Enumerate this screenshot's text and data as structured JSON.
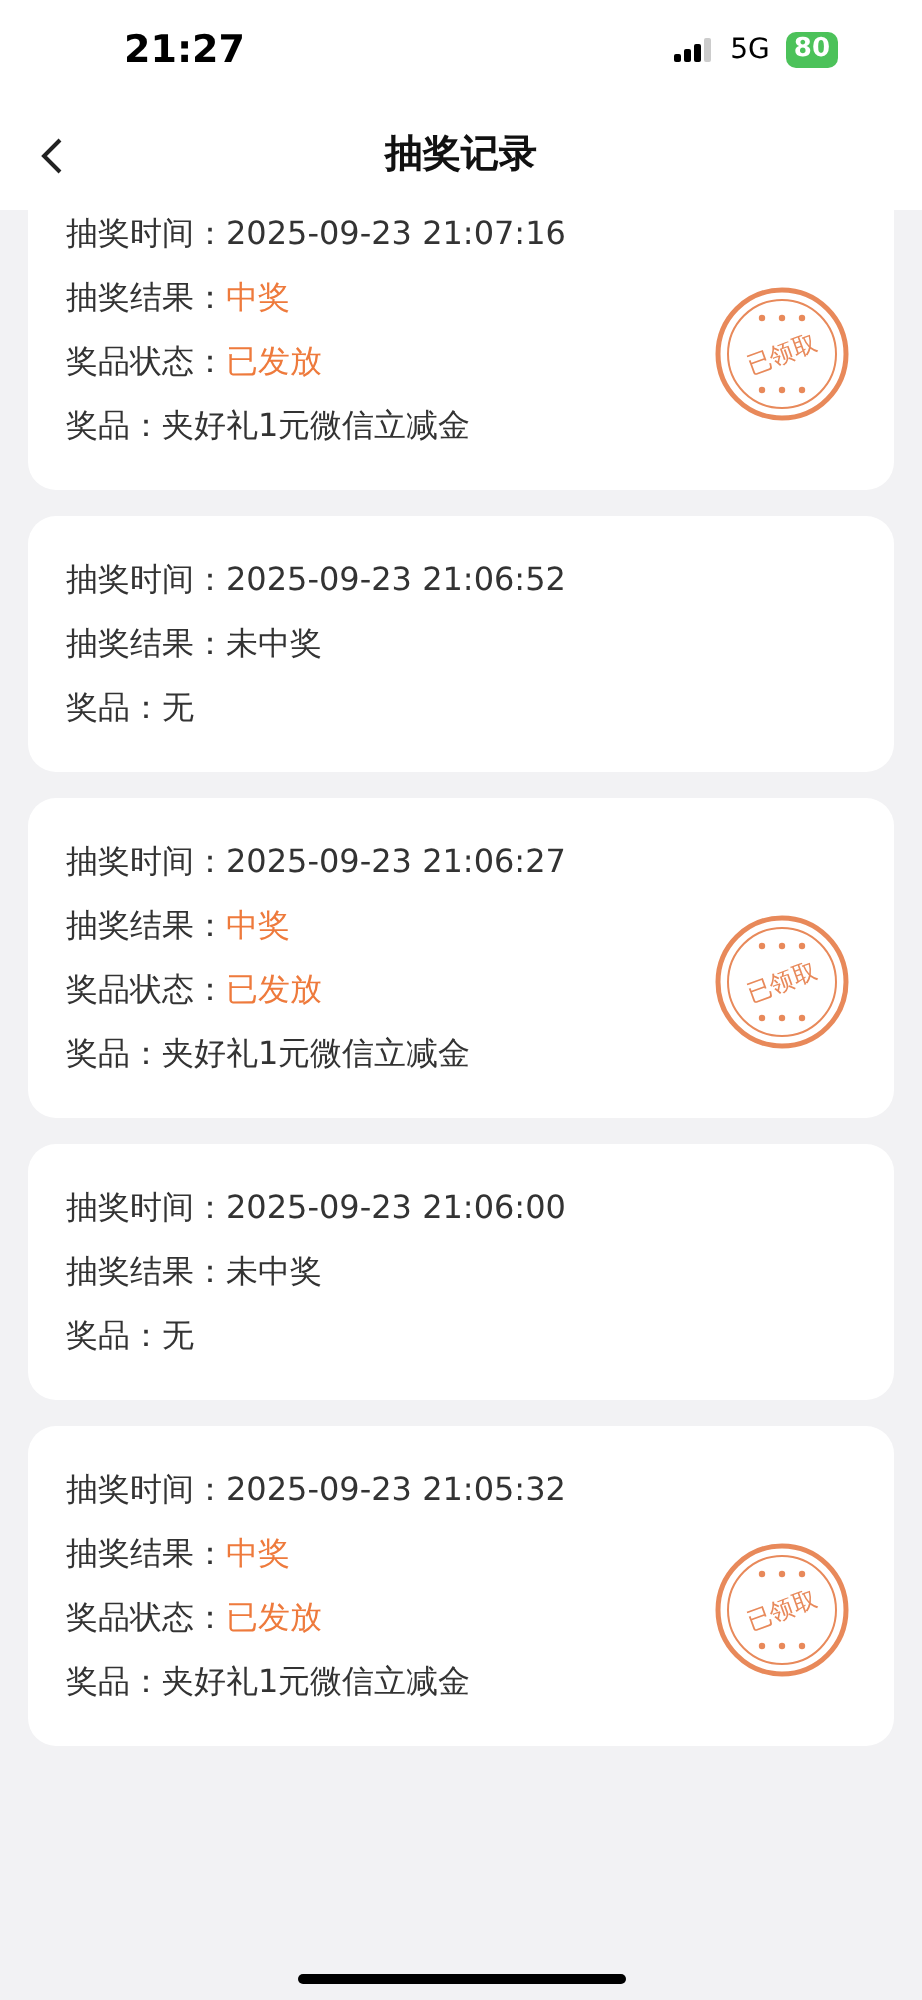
{
  "status_bar": {
    "time": "21:27",
    "network": "5G",
    "battery": "80"
  },
  "nav": {
    "title": "抽奖记录"
  },
  "records": [
    {
      "stamp": "已领取",
      "rows": [
        {
          "label": "抽奖时间：",
          "value": "2025-09-23 21:07:16",
          "accent": false
        },
        {
          "label": "抽奖结果：",
          "value": "中奖",
          "accent": true
        },
        {
          "label": "奖品状态：",
          "value": "已发放",
          "accent": true
        },
        {
          "label": "奖品：",
          "value": "夹好礼1元微信立减金",
          "accent": false
        }
      ]
    },
    {
      "rows": [
        {
          "label": "抽奖时间：",
          "value": "2025-09-23 21:06:52",
          "accent": false
        },
        {
          "label": "抽奖结果：",
          "value": "未中奖",
          "accent": false
        },
        {
          "label": "奖品：",
          "value": "无",
          "accent": false
        }
      ]
    },
    {
      "stamp": "已领取",
      "rows": [
        {
          "label": "抽奖时间：",
          "value": "2025-09-23 21:06:27",
          "accent": false
        },
        {
          "label": "抽奖结果：",
          "value": "中奖",
          "accent": true
        },
        {
          "label": "奖品状态：",
          "value": "已发放",
          "accent": true
        },
        {
          "label": "奖品：",
          "value": "夹好礼1元微信立减金",
          "accent": false
        }
      ]
    },
    {
      "rows": [
        {
          "label": "抽奖时间：",
          "value": "2025-09-23 21:06:00",
          "accent": false
        },
        {
          "label": "抽奖结果：",
          "value": "未中奖",
          "accent": false
        },
        {
          "label": "奖品：",
          "value": "无",
          "accent": false
        }
      ]
    },
    {
      "stamp": "已领取",
      "rows": [
        {
          "label": "抽奖时间：",
          "value": "2025-09-23 21:05:32",
          "accent": false
        },
        {
          "label": "抽奖结果：",
          "value": "中奖",
          "accent": true
        },
        {
          "label": "奖品状态：",
          "value": "已发放",
          "accent": true
        },
        {
          "label": "奖品：",
          "value": "夹好礼1元微信立减金",
          "accent": false
        }
      ]
    }
  ]
}
